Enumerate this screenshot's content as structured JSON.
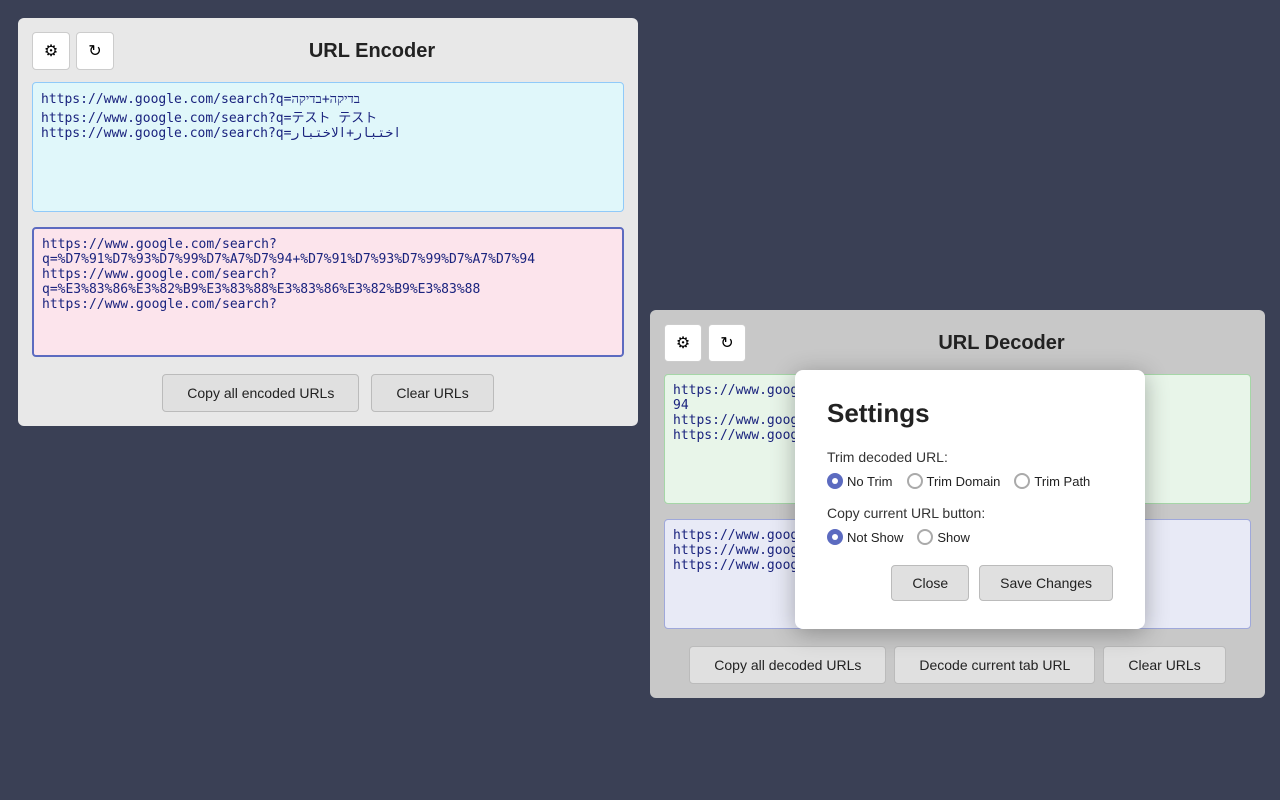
{
  "encoder": {
    "title": "URL Encoder",
    "gear_icon": "⚙",
    "refresh_icon": "↻",
    "input_text": "https://www.google.com/search?q=בדיקה+בדיקה\nhttps://www.google.com/search?q=テスト テスト\nhttps://www.google.com/search?q=اختبار+الاختبار",
    "output_text": "https://www.google.com/search?q=%D7%91%D7%93%D7%99%D7%A7%D7%94+%D7%91%D7%93%D7%99%D7%A7%D7%94\nhttps://www.google.com/search?q=%E3%83%86%E3%82%B9%E3%83%88%E3%83%86%E3%82%B9%E3%83%88\nhttps://www.google.com/search?",
    "copy_btn": "Copy all encoded URLs",
    "clear_btn": "Clear URLs"
  },
  "decoder": {
    "title": "URL Decoder",
    "gear_icon": "⚙",
    "refresh_icon": "↻",
    "input_text": "https://www.goog...q=%D7%91%D7%...D7%A7%D7%\n94\nhttps://www.goog...q=%E3%83%86%E...%88\nhttps://www.goog...",
    "output_text": "https://www.goog...\nhttps://www.goog...\nhttps://www.goog...",
    "copy_btn": "Copy all decoded URLs",
    "decode_tab_btn": "Decode current tab URL",
    "clear_btn": "Clear URLs"
  },
  "settings": {
    "title": "Settings",
    "trim_label": "Trim decoded URL:",
    "trim_options": [
      {
        "id": "no-trim",
        "label": "No Trim",
        "selected": true
      },
      {
        "id": "trim-domain",
        "label": "Trim Domain",
        "selected": false
      },
      {
        "id": "trim-path",
        "label": "Trim Path",
        "selected": false
      }
    ],
    "copy_btn_label": "Copy current URL button:",
    "copy_options": [
      {
        "id": "not-show",
        "label": "Not Show",
        "selected": true
      },
      {
        "id": "show",
        "label": "Show",
        "selected": false
      }
    ],
    "close_btn": "Close",
    "save_btn": "Save Changes"
  }
}
